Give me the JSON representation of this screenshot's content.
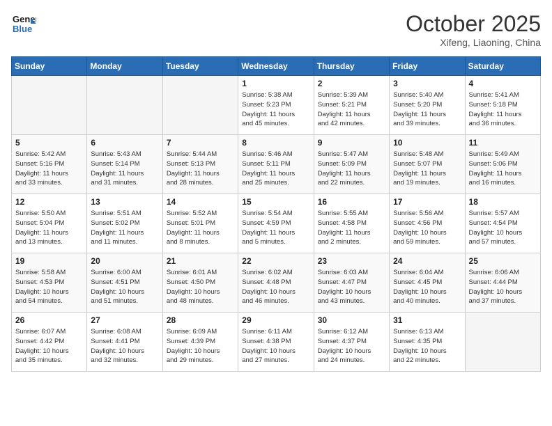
{
  "header": {
    "logo_line1": "General",
    "logo_line2": "Blue",
    "month": "October 2025",
    "location": "Xifeng, Liaoning, China"
  },
  "weekdays": [
    "Sunday",
    "Monday",
    "Tuesday",
    "Wednesday",
    "Thursday",
    "Friday",
    "Saturday"
  ],
  "weeks": [
    [
      {
        "day": "",
        "info": ""
      },
      {
        "day": "",
        "info": ""
      },
      {
        "day": "",
        "info": ""
      },
      {
        "day": "1",
        "info": "Sunrise: 5:38 AM\nSunset: 5:23 PM\nDaylight: 11 hours\nand 45 minutes."
      },
      {
        "day": "2",
        "info": "Sunrise: 5:39 AM\nSunset: 5:21 PM\nDaylight: 11 hours\nand 42 minutes."
      },
      {
        "day": "3",
        "info": "Sunrise: 5:40 AM\nSunset: 5:20 PM\nDaylight: 11 hours\nand 39 minutes."
      },
      {
        "day": "4",
        "info": "Sunrise: 5:41 AM\nSunset: 5:18 PM\nDaylight: 11 hours\nand 36 minutes."
      }
    ],
    [
      {
        "day": "5",
        "info": "Sunrise: 5:42 AM\nSunset: 5:16 PM\nDaylight: 11 hours\nand 33 minutes."
      },
      {
        "day": "6",
        "info": "Sunrise: 5:43 AM\nSunset: 5:14 PM\nDaylight: 11 hours\nand 31 minutes."
      },
      {
        "day": "7",
        "info": "Sunrise: 5:44 AM\nSunset: 5:13 PM\nDaylight: 11 hours\nand 28 minutes."
      },
      {
        "day": "8",
        "info": "Sunrise: 5:46 AM\nSunset: 5:11 PM\nDaylight: 11 hours\nand 25 minutes."
      },
      {
        "day": "9",
        "info": "Sunrise: 5:47 AM\nSunset: 5:09 PM\nDaylight: 11 hours\nand 22 minutes."
      },
      {
        "day": "10",
        "info": "Sunrise: 5:48 AM\nSunset: 5:07 PM\nDaylight: 11 hours\nand 19 minutes."
      },
      {
        "day": "11",
        "info": "Sunrise: 5:49 AM\nSunset: 5:06 PM\nDaylight: 11 hours\nand 16 minutes."
      }
    ],
    [
      {
        "day": "12",
        "info": "Sunrise: 5:50 AM\nSunset: 5:04 PM\nDaylight: 11 hours\nand 13 minutes."
      },
      {
        "day": "13",
        "info": "Sunrise: 5:51 AM\nSunset: 5:02 PM\nDaylight: 11 hours\nand 11 minutes."
      },
      {
        "day": "14",
        "info": "Sunrise: 5:52 AM\nSunset: 5:01 PM\nDaylight: 11 hours\nand 8 minutes."
      },
      {
        "day": "15",
        "info": "Sunrise: 5:54 AM\nSunset: 4:59 PM\nDaylight: 11 hours\nand 5 minutes."
      },
      {
        "day": "16",
        "info": "Sunrise: 5:55 AM\nSunset: 4:58 PM\nDaylight: 11 hours\nand 2 minutes."
      },
      {
        "day": "17",
        "info": "Sunrise: 5:56 AM\nSunset: 4:56 PM\nDaylight: 10 hours\nand 59 minutes."
      },
      {
        "day": "18",
        "info": "Sunrise: 5:57 AM\nSunset: 4:54 PM\nDaylight: 10 hours\nand 57 minutes."
      }
    ],
    [
      {
        "day": "19",
        "info": "Sunrise: 5:58 AM\nSunset: 4:53 PM\nDaylight: 10 hours\nand 54 minutes."
      },
      {
        "day": "20",
        "info": "Sunrise: 6:00 AM\nSunset: 4:51 PM\nDaylight: 10 hours\nand 51 minutes."
      },
      {
        "day": "21",
        "info": "Sunrise: 6:01 AM\nSunset: 4:50 PM\nDaylight: 10 hours\nand 48 minutes."
      },
      {
        "day": "22",
        "info": "Sunrise: 6:02 AM\nSunset: 4:48 PM\nDaylight: 10 hours\nand 46 minutes."
      },
      {
        "day": "23",
        "info": "Sunrise: 6:03 AM\nSunset: 4:47 PM\nDaylight: 10 hours\nand 43 minutes."
      },
      {
        "day": "24",
        "info": "Sunrise: 6:04 AM\nSunset: 4:45 PM\nDaylight: 10 hours\nand 40 minutes."
      },
      {
        "day": "25",
        "info": "Sunrise: 6:06 AM\nSunset: 4:44 PM\nDaylight: 10 hours\nand 37 minutes."
      }
    ],
    [
      {
        "day": "26",
        "info": "Sunrise: 6:07 AM\nSunset: 4:42 PM\nDaylight: 10 hours\nand 35 minutes."
      },
      {
        "day": "27",
        "info": "Sunrise: 6:08 AM\nSunset: 4:41 PM\nDaylight: 10 hours\nand 32 minutes."
      },
      {
        "day": "28",
        "info": "Sunrise: 6:09 AM\nSunset: 4:39 PM\nDaylight: 10 hours\nand 29 minutes."
      },
      {
        "day": "29",
        "info": "Sunrise: 6:11 AM\nSunset: 4:38 PM\nDaylight: 10 hours\nand 27 minutes."
      },
      {
        "day": "30",
        "info": "Sunrise: 6:12 AM\nSunset: 4:37 PM\nDaylight: 10 hours\nand 24 minutes."
      },
      {
        "day": "31",
        "info": "Sunrise: 6:13 AM\nSunset: 4:35 PM\nDaylight: 10 hours\nand 22 minutes."
      },
      {
        "day": "",
        "info": ""
      }
    ]
  ]
}
